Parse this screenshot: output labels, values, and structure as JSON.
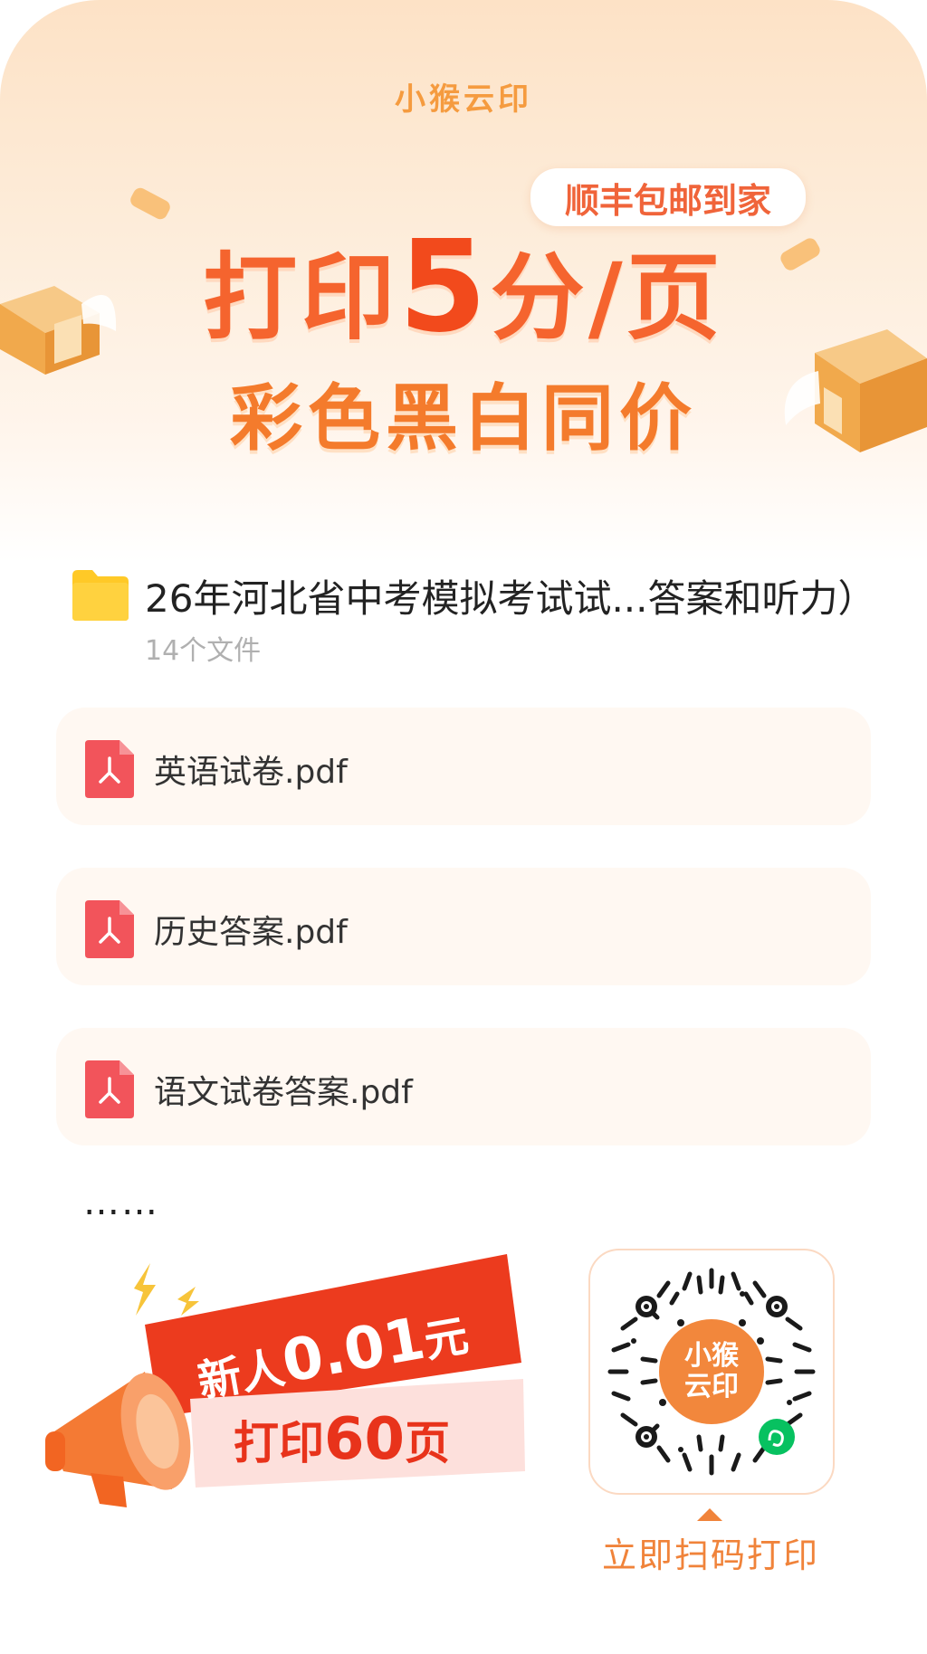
{
  "brand": {
    "name": "小猴云印"
  },
  "banner": {
    "tag": "顺丰包邮到家",
    "headline_pre": "打印",
    "headline_num": "5",
    "headline_post": "分/页",
    "subheadline": "彩色黑白同价"
  },
  "folder": {
    "title": "26年河北省中考模拟考试试...答案和听力）",
    "count": "14个文件"
  },
  "files": [
    {
      "name": "英语试卷.pdf"
    },
    {
      "name": "历史答案.pdf"
    },
    {
      "name": "语文试卷答案.pdf"
    }
  ],
  "more": "……",
  "promo": {
    "line1_pre": "新人",
    "line1_num": "0.01",
    "line1_post": "元",
    "line2_pre": "打印",
    "line2_num": "60",
    "line2_post": "页"
  },
  "qr": {
    "center_text_1": "小猴",
    "center_text_2": "云印",
    "cta": "立即扫码打印"
  },
  "colors": {
    "accent": "#f5642e",
    "orange": "#f0833a",
    "pdf_red": "#f2545b",
    "folder_yellow": "#ffc927"
  }
}
